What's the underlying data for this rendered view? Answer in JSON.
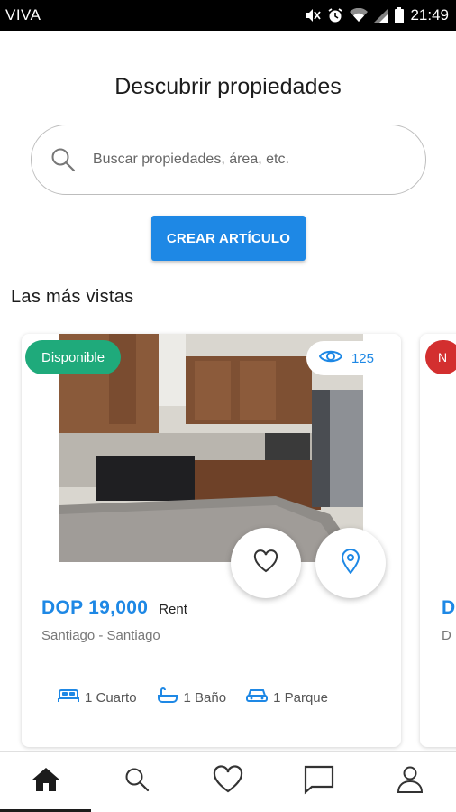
{
  "status_bar": {
    "carrier": "VIVA",
    "time": "21:49"
  },
  "header": {
    "title": "Descubrir propiedades"
  },
  "search": {
    "placeholder": "Buscar propiedades, área, etc."
  },
  "create_button": {
    "label": "CREAR ARTÍCULO"
  },
  "section": {
    "title": "Las más vistas"
  },
  "colors": {
    "accent": "#1e88e5",
    "available": "#1faa7b",
    "unavailable": "#d32f2f"
  },
  "listings": [
    {
      "status": "Disponible",
      "views": "125",
      "price": "DOP 19,000",
      "price_type": "Rent",
      "location": "Santiago - Santiago",
      "amenities": [
        {
          "icon": "bed-icon",
          "label": "1 Cuarto"
        },
        {
          "icon": "bathtub-icon",
          "label": "1 Baño"
        },
        {
          "icon": "car-icon",
          "label": "1 Parque"
        }
      ]
    },
    {
      "status": "N",
      "price": "D",
      "location": "D"
    }
  ],
  "bottom_nav": [
    {
      "icon": "home-icon",
      "active": true
    },
    {
      "icon": "search-icon",
      "active": false
    },
    {
      "icon": "heart-icon",
      "active": false
    },
    {
      "icon": "chat-icon",
      "active": false
    },
    {
      "icon": "profile-icon",
      "active": false
    }
  ]
}
